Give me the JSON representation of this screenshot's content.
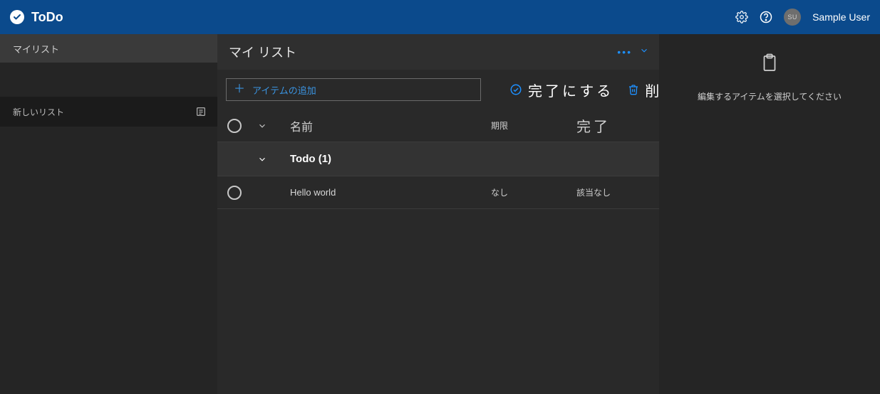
{
  "topbar": {
    "app_title": "ToDo",
    "user_initials": "SU",
    "user_name": "Sample User"
  },
  "sidebar": {
    "active_item": "マイリスト",
    "new_list_label": "新しいリスト"
  },
  "main": {
    "title": "マイ リスト",
    "add_item_label": "アイテムの追加",
    "complete_label": "完了にする",
    "delete_label": "削除",
    "columns": {
      "name": "名前",
      "due": "期限",
      "done": "完了"
    },
    "group": {
      "label": "Todo (1)"
    },
    "rows": [
      {
        "name": "Hello world",
        "due": "なし",
        "done": "該当なし"
      }
    ]
  },
  "detail": {
    "hint": "編集するアイテムを選択してください"
  }
}
